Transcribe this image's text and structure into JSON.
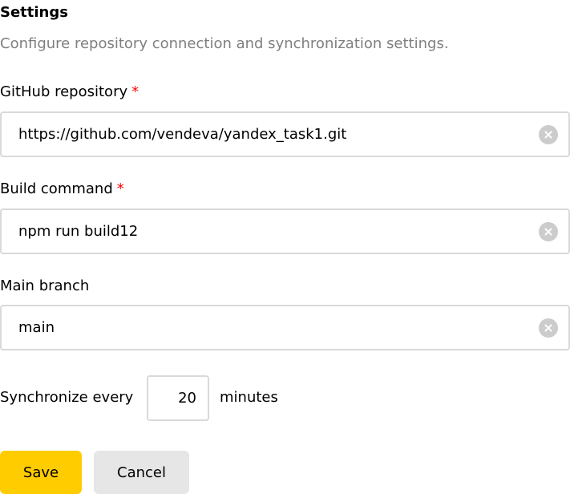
{
  "page": {
    "title": "Settings",
    "subtitle": "Configure repository connection and synchronization settings."
  },
  "fields": {
    "repository": {
      "label": "GitHub repository",
      "required_mark": "*",
      "value": "https://github.com/vendeva/yandex_task1.git"
    },
    "build_command": {
      "label": "Build command",
      "required_mark": "*",
      "value": "npm run build12"
    },
    "main_branch": {
      "label": "Main branch",
      "value": "main"
    }
  },
  "sync": {
    "prefix": "Synchronize every",
    "value": "20",
    "suffix": "minutes"
  },
  "actions": {
    "save_label": "Save",
    "cancel_label": "Cancel"
  },
  "colors": {
    "accent": "#ffcc00",
    "required": "#ff0000",
    "border": "#d9d9d9",
    "muted_text": "#7f7f7f",
    "secondary_button": "#e6e6e6"
  }
}
